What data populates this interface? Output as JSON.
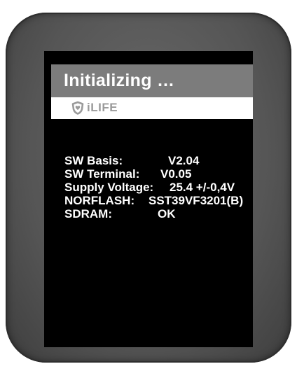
{
  "screen": {
    "title": "Initializing …",
    "logo": {
      "icon": "shield-heart-icon",
      "text": "iLIFE"
    },
    "info_rows": [
      {
        "label": "SW Basis:",
        "value": "V2.04"
      },
      {
        "label": "SW Terminal:",
        "value": "V0.05"
      },
      {
        "label": "Supply Voltage:",
        "value": "25.4 +/-0,4V"
      },
      {
        "label": "NORFLASH:",
        "value": "SST39VF3201(B)"
      },
      {
        "label": "SDRAM:",
        "value": "OK"
      }
    ]
  },
  "colors": {
    "bezel": "#555555",
    "screen_bg": "#000000",
    "title_bar": "#7c7c7c",
    "text": "#ffffff",
    "logo_gray": "#9a9a9a"
  }
}
